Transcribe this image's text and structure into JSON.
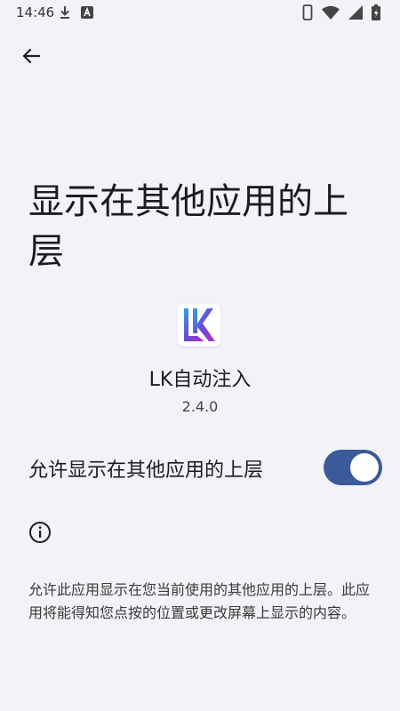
{
  "status_bar": {
    "time": "14:46",
    "left_icons": [
      "download-icon",
      "a-notification-icon"
    ],
    "right_icons": [
      "vibrate-icon",
      "wifi-icon",
      "signal-icon",
      "battery-icon"
    ]
  },
  "header": {
    "back_icon": "arrow-left-icon",
    "title": "显示在其他应用的上层"
  },
  "app": {
    "icon": "lk-logo-icon",
    "name": "LK自动注入",
    "version": "2.4.0"
  },
  "permission": {
    "label": "允许显示在其他应用的上层",
    "enabled": true,
    "toggle_color": "#3a5a9a"
  },
  "info": {
    "icon": "info-icon",
    "text": "允许此应用显示在您当前使用的其他应用的上层。此应用将能得知您点按的位置或更改屏幕上显示的内容。"
  },
  "colors": {
    "background": "#f2f2f7",
    "text": "#1c1b1f"
  }
}
